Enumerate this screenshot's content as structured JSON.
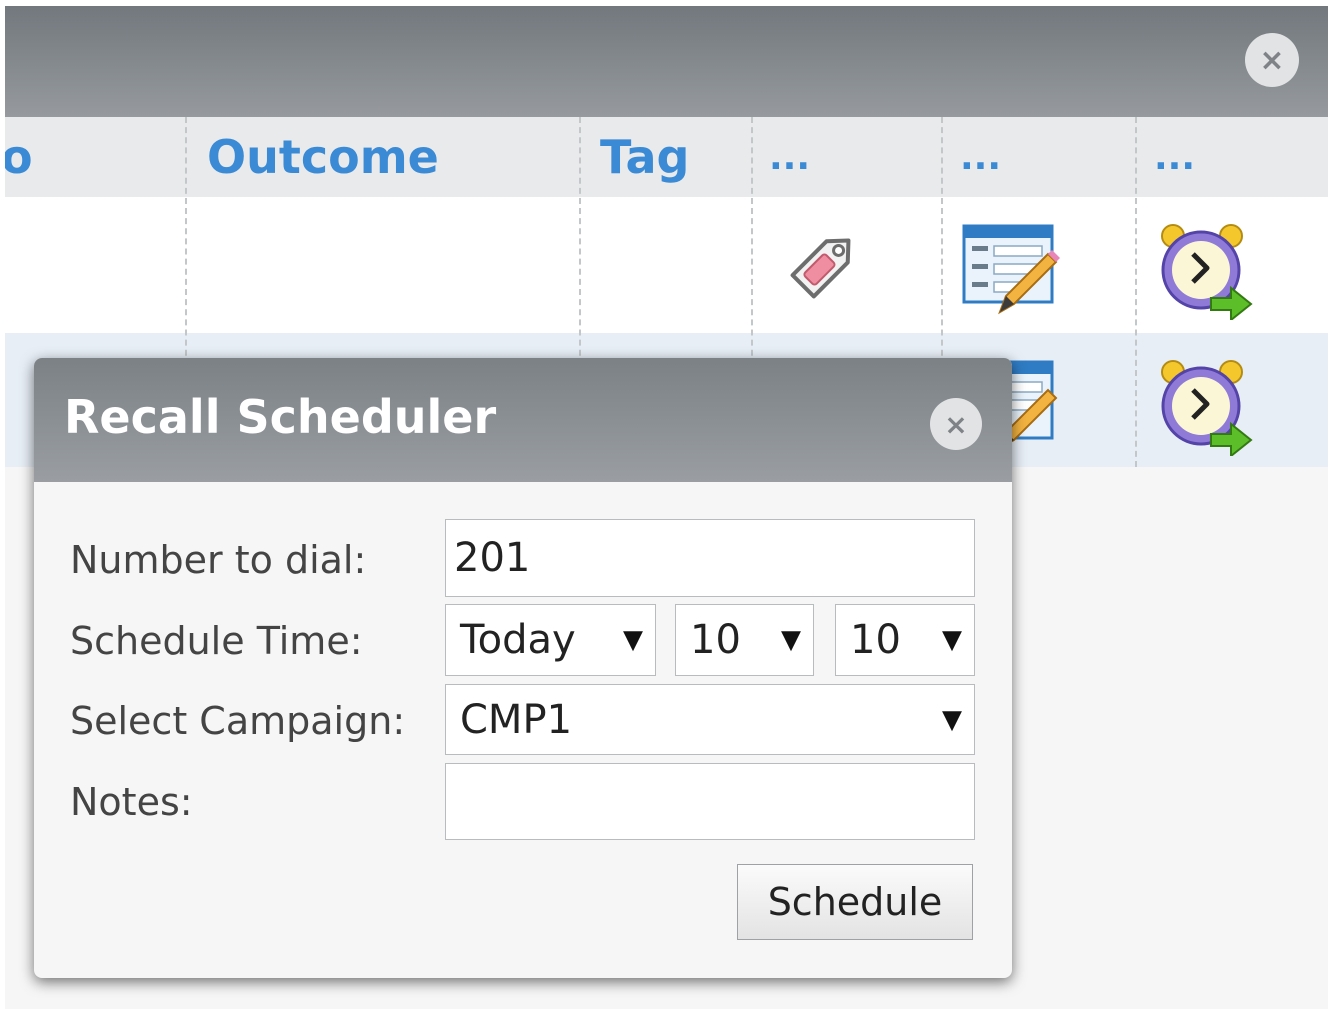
{
  "panel": {
    "close_icon": "×",
    "columns": [
      "o",
      "Outcome",
      "Tag",
      "...",
      "...",
      "..."
    ],
    "row_icons": [
      [
        "tag-icon",
        "form-edit-icon",
        "alarm-clock-recall-icon"
      ],
      [
        "form-edit-icon",
        "alarm-clock-recall-icon"
      ]
    ]
  },
  "modal": {
    "title": "Recall Scheduler",
    "close_icon": "×",
    "labels": {
      "number": "Number to dial:",
      "schedule_time": "Schedule Time:",
      "campaign": "Select Campaign:",
      "notes": "Notes:"
    },
    "number_value": "201",
    "day_value": "Today",
    "hour_value": "10",
    "minute_value": "10",
    "campaign_value": "CMP1",
    "notes_value": "",
    "dropdown_arrow": "▼",
    "schedule_button": "Schedule"
  },
  "colors": {
    "header_link": "#3a8ad6",
    "header_bar": "#888c90",
    "row_highlight": "#e7eef6"
  }
}
